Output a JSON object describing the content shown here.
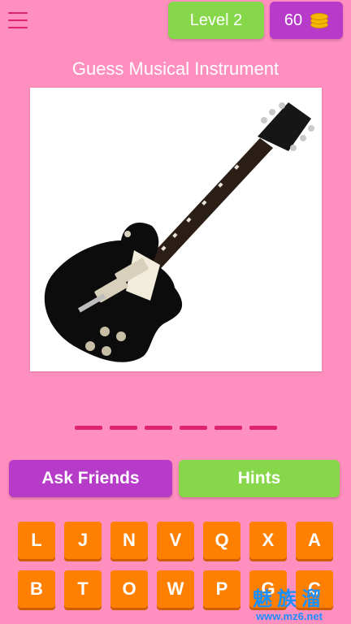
{
  "header": {
    "menu_icon": "hamburger-menu-icon",
    "level_label": "Level 2",
    "coins": "60",
    "coin_icon": "coin-stack-icon"
  },
  "title": "Guess Musical Instrument",
  "picture": {
    "subject": "electric-guitar-image"
  },
  "answer": {
    "slot_count": 6
  },
  "actions": {
    "ask_friends": "Ask Friends",
    "hints": "Hints"
  },
  "letters": {
    "row1": [
      "L",
      "J",
      "N",
      "V",
      "Q",
      "X",
      "A"
    ],
    "row2": [
      "B",
      "T",
      "O",
      "W",
      "P",
      "G",
      "C"
    ]
  },
  "watermark": {
    "text": "魅族溜",
    "url": "www.mz6.net"
  },
  "colors": {
    "background": "#ff8fbf",
    "accent_pink": "#e0216f",
    "green": "#86d84a",
    "purple": "#b53bc8",
    "tile_orange": "#ff7f00"
  }
}
